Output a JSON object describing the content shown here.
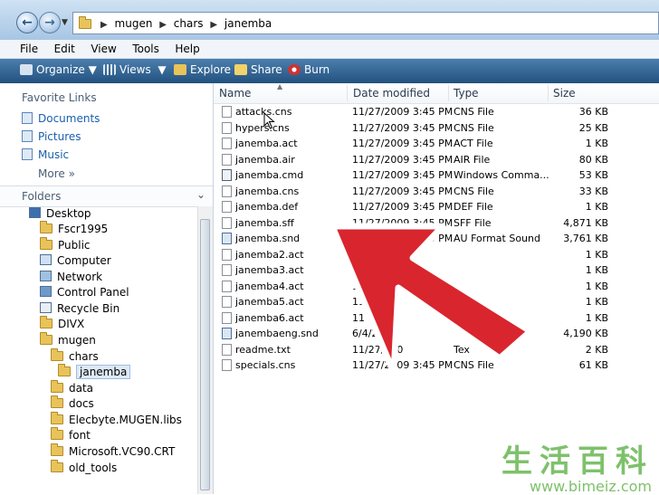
{
  "address": {
    "crumbs": [
      "mugen",
      "chars",
      "janemba"
    ]
  },
  "menu": [
    "File",
    "Edit",
    "View",
    "Tools",
    "Help"
  ],
  "toolbar": {
    "organize": "Organize",
    "views": "Views",
    "explore": "Explore",
    "share": "Share",
    "burn": "Burn"
  },
  "favorites": {
    "header": "Favorite Links",
    "links": [
      "Documents",
      "Pictures",
      "Music"
    ],
    "more": "More"
  },
  "folders": {
    "header": "Folders",
    "tree": [
      "Desktop",
      "Fscr1995",
      "Public",
      "Computer",
      "Network",
      "Control Panel",
      "Recycle Bin",
      "DIVX",
      "mugen",
      "chars",
      "janemba",
      "data",
      "docs",
      "Elecbyte.MUGEN.libs",
      "font",
      "Microsoft.VC90.CRT",
      "old_tools"
    ]
  },
  "columns": {
    "name": "Name",
    "date": "Date modified",
    "type": "Type",
    "size": "Size"
  },
  "files": [
    {
      "name": "attacks.cns",
      "date": "11/27/2009 3:45 PM",
      "type": "CNS File",
      "size": "36 KB"
    },
    {
      "name": "hypers.cns",
      "date": "11/27/2009 3:45 PM",
      "type": "CNS File",
      "size": "25 KB"
    },
    {
      "name": "janemba.act",
      "date": "11/27/2009 3:45 PM",
      "type": "ACT File",
      "size": "1 KB"
    },
    {
      "name": "janemba.air",
      "date": "11/27/2009 3:45 PM",
      "type": "AIR File",
      "size": "80 KB"
    },
    {
      "name": "janemba.cmd",
      "date": "11/27/2009 3:45 PM",
      "type": "Windows Comma...",
      "size": "53 KB"
    },
    {
      "name": "janemba.cns",
      "date": "11/27/2009 3:45 PM",
      "type": "CNS File",
      "size": "33 KB"
    },
    {
      "name": "janemba.def",
      "date": "11/27/2009 3:45 PM",
      "type": "DEF File",
      "size": "1 KB"
    },
    {
      "name": "janemba.sff",
      "date": "11/27/2009 3:45 PM",
      "type": "SFF File",
      "size": "4,871 KB"
    },
    {
      "name": "janemba.snd",
      "date": "11/27/2009 3:45 PM",
      "type": "AU Format Sound",
      "size": "3,761 KB"
    },
    {
      "name": "janemba2.act",
      "date": "",
      "type": "",
      "size": "1 KB"
    },
    {
      "name": "janemba3.act",
      "date": "",
      "type": "",
      "size": "1 KB"
    },
    {
      "name": "janemba4.act",
      "date": "11",
      "type": "",
      "size": "1 KB"
    },
    {
      "name": "janemba5.act",
      "date": "11",
      "type": "",
      "size": "1 KB"
    },
    {
      "name": "janemba6.act",
      "date": "11",
      "type": "",
      "size": "1 KB"
    },
    {
      "name": "janembaeng.snd",
      "date": "6/4/200",
      "type": "",
      "size": "4,190 KB"
    },
    {
      "name": "readme.txt",
      "date": "11/27/200",
      "type": "Tex",
      "size": "2 KB"
    },
    {
      "name": "specials.cns",
      "date": "11/27/2009 3:45 PM",
      "type": "CNS File",
      "size": "61 KB"
    }
  ],
  "watermark": {
    "cn": "生活百科",
    "url": "www.bimeiz.com"
  },
  "colors": {
    "arrow": "#d9252e",
    "toolbar": "#2f5f8e",
    "link": "#1a5fae"
  }
}
